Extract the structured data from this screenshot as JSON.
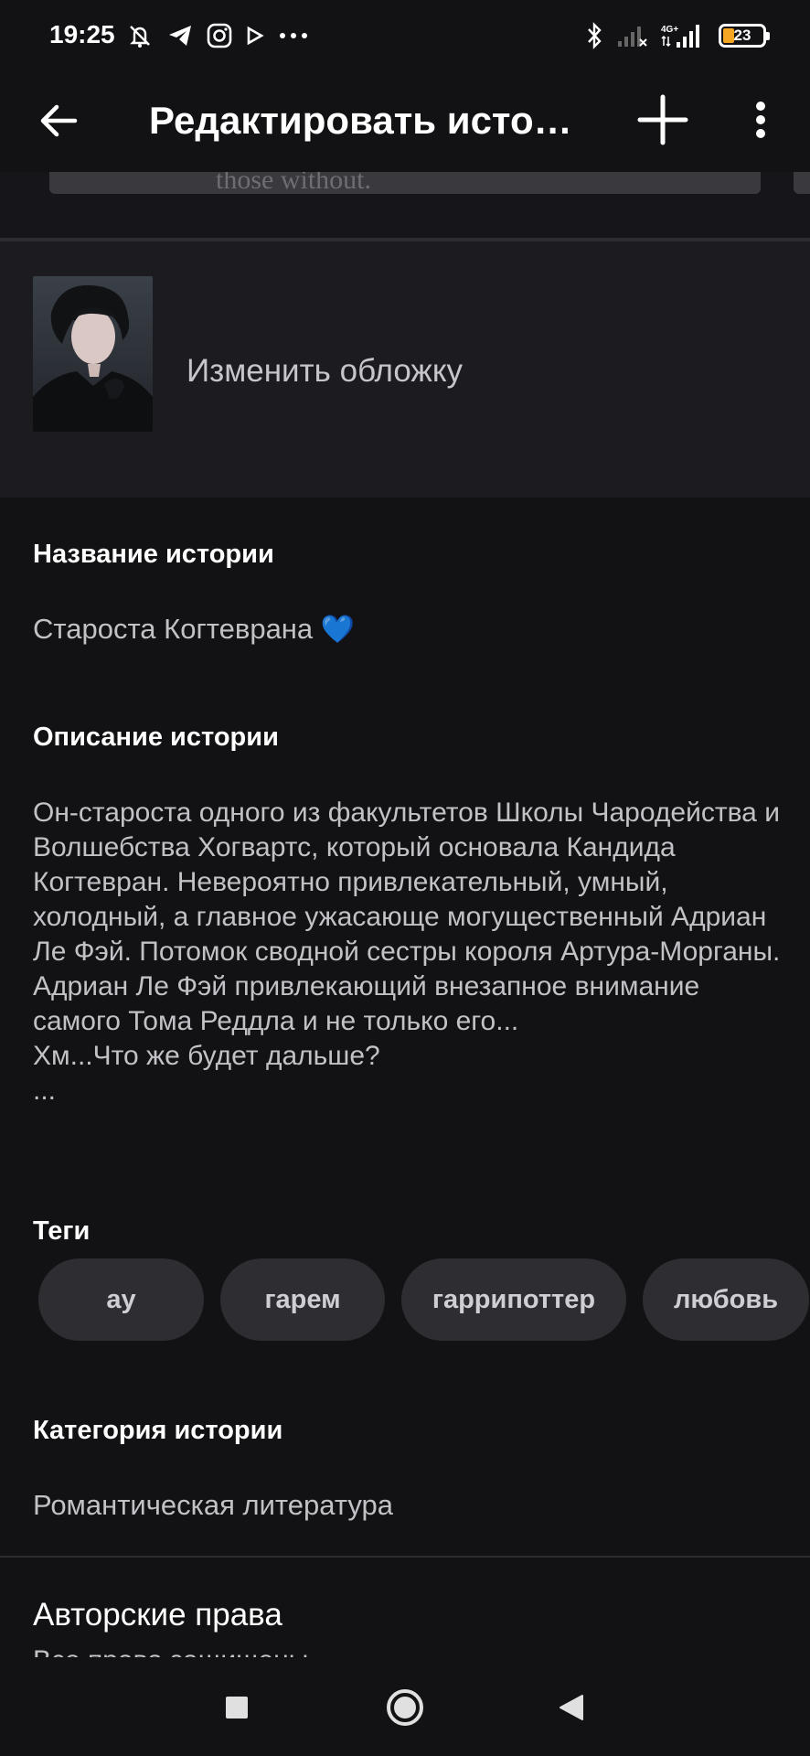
{
  "status_bar": {
    "time": "19:25",
    "battery": "23",
    "network": "4G+",
    "accent": "#f5a623",
    "left_icons": [
      "mute-icon",
      "telegram-icon",
      "instagram-icon",
      "play-icon",
      "more-dots-icon"
    ],
    "right_icons": [
      "bluetooth-icon",
      "signal-icon",
      "signal-4g-icon",
      "battery-icon"
    ]
  },
  "app_bar": {
    "title": "Редактировать историю",
    "back_icon": "arrow-left-icon",
    "add_icon": "plus-icon",
    "more_icon": "more-vert-icon"
  },
  "top_strip": {
    "partial_text": "those without."
  },
  "cover": {
    "change_label": "Изменить обложку"
  },
  "story": {
    "title_label": "Название истории",
    "title_value": "Староста Когтеврана",
    "title_emoji": "💙",
    "description_label": "Описание истории",
    "description_value": "Он-староста одного из факультетов Школы Чародейства и Волшебства Хогвартс, который основала Кандида Когтевран. Невероятно привлекательный, умный, холодный, а главное ужасающе могущественный Адриан Ле Фэй. Потомок сводной сестры короля Артура-Морганы. Адриан Ле Фэй привлекающий внезапное внимание самого Тома Реддла и не только его...\nХм...Что же будет дальше?\n...",
    "tags_label": "Теги",
    "tags": [
      "ау",
      "гарем",
      "гаррипоттер",
      "любовь"
    ],
    "category_label": "Категория истории",
    "category_value": "Романтическая литература",
    "copyright_label": "Авторские права",
    "copyright_value": "Все права защищены"
  },
  "nav_bar": {
    "icons": [
      "recents-square-icon",
      "home-circle-icon",
      "back-triangle-icon"
    ]
  }
}
